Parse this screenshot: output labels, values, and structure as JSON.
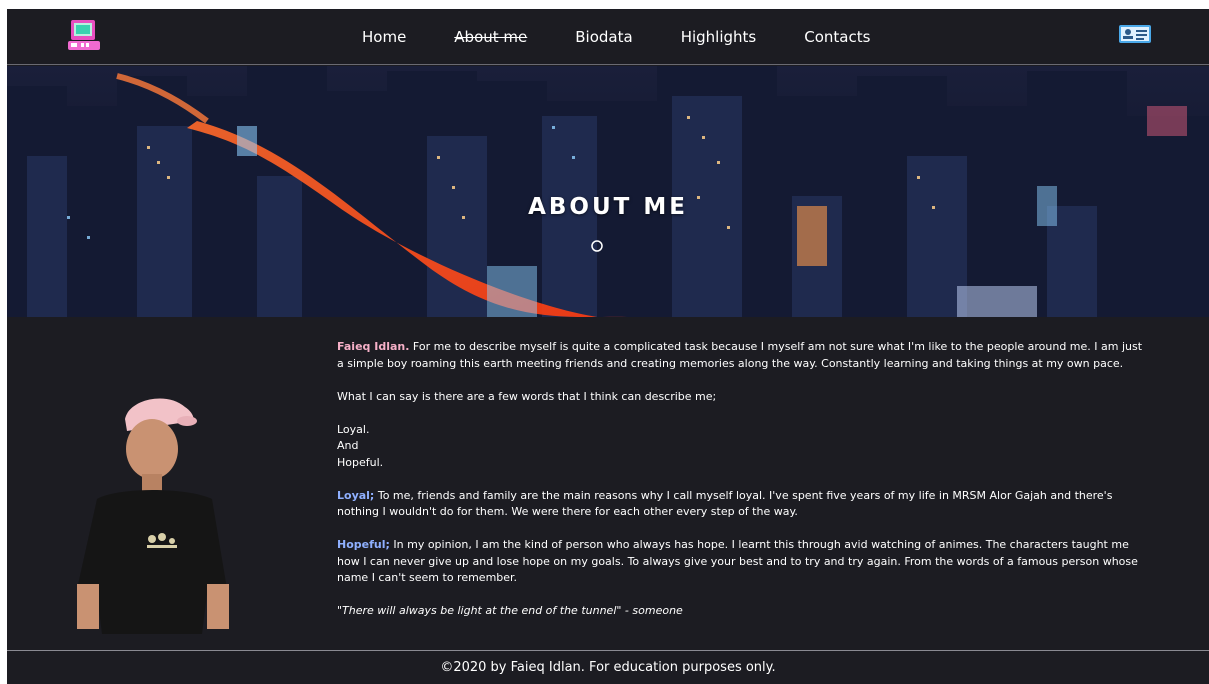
{
  "nav": {
    "items": [
      {
        "label": "Home",
        "active": false
      },
      {
        "label": "About me",
        "active": true
      },
      {
        "label": "Biodata",
        "active": false
      },
      {
        "label": "Highlights",
        "active": false
      },
      {
        "label": "Contacts",
        "active": false
      }
    ]
  },
  "hero": {
    "title": "ABOUT  ME"
  },
  "about": {
    "intro_name": "Faieq Idlan.",
    "intro_text": " For me to describe myself is quite a complicated task because I myself am not sure what I'm like to the people around me. I am just a simple boy roaming this earth meeting friends and creating memories along the way. Constantly learning and taking things at my own pace.",
    "words_intro": "What I can say is there are a few words that I think can describe me;",
    "word1": "Loyal.",
    "word_and": "And",
    "word2": "Hopeful.",
    "loyal_label": "Loyal;",
    "loyal_text": " To me, friends and family are the main reasons why I call myself loyal. I've spent five years of my life in MRSM Alor Gajah and there's nothing I wouldn't do for them. We were there for each other every step of the way.",
    "hopeful_label": "Hopeful;",
    "hopeful_text": " In my opinion, I am the kind of person who always has hope. I learnt this through avid watching of animes. The characters taught me how I can never give up and lose hope on my goals. To always give your best and to try and try again. From the words of a famous person whose name I can't seem to remember.",
    "quote": "\"There will always be light at the end of the tunnel\" - someone"
  },
  "footer": {
    "text": "©2020 by Faieq Idlan. For education purposes only."
  },
  "colors": {
    "background": "#1c1c22",
    "highlight_pink": "#f6b0c8",
    "highlight_blue": "#8fb0ff",
    "logo_pink": "#e84fc0",
    "card_blue": "#4aa8e8"
  },
  "icons": {
    "logo": "retro-computer-icon",
    "contact": "contact-card-icon"
  }
}
